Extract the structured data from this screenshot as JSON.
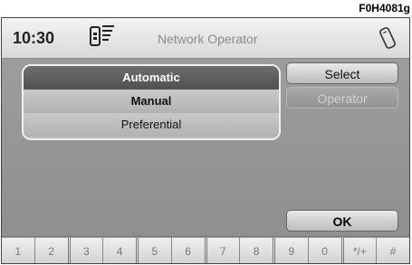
{
  "figure_code": "F0H4081g",
  "status": {
    "time": "10:30",
    "title": "Network Operator"
  },
  "list": {
    "items": [
      "Automatic",
      "Manual",
      "Preferential"
    ]
  },
  "buttons": {
    "select": "Select",
    "operator": "Operator",
    "ok": "OK"
  },
  "keypad": [
    "1",
    "2",
    "3",
    "4",
    "5",
    "6",
    "7",
    "8",
    "9",
    "0",
    "*/+",
    "#"
  ],
  "icons": {
    "signal": "signal-strength-icon",
    "phone": "phone-icon"
  }
}
